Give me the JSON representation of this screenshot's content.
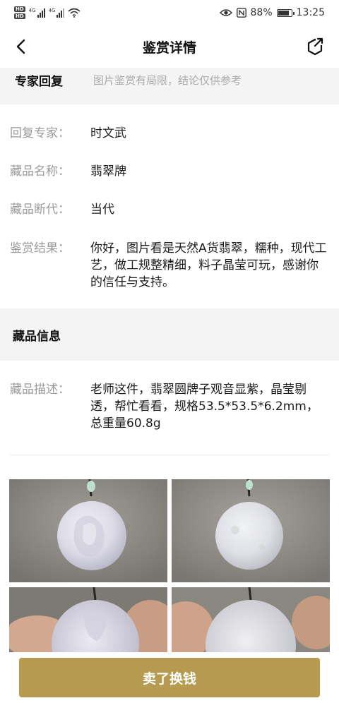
{
  "status_bar": {
    "network_left": [
      "HD",
      "HD"
    ],
    "sig1_tag": "4G",
    "sig2_tag": "4G",
    "battery_percent": "88%",
    "battery_level": 0.88,
    "time": "13:25",
    "icons": [
      "hd-icon",
      "signal-icon",
      "wifi-icon",
      "eye-icon",
      "nfc-icon",
      "battery-icon"
    ]
  },
  "nav": {
    "title": "鉴赏详情",
    "back_icon": "chevron-left-icon",
    "share_icon": "share-icon"
  },
  "expert_section": {
    "title": "专家回复",
    "note": "图片鉴赏有局限，结论仅供参考"
  },
  "expert_reply": [
    {
      "label": "回复专家：",
      "value": "时文武"
    },
    {
      "label": "藏品名称：",
      "value": "翡翠牌"
    },
    {
      "label": "藏品断代：",
      "value": "当代"
    },
    {
      "label": "鉴赏结果：",
      "value": "你好，图片看是天然A货翡翠，糯种，现代工艺，做工规整精细，料子晶莹可玩，感谢你的信任与支持。"
    }
  ],
  "info_section": {
    "title": "藏品信息"
  },
  "item_info": {
    "label": "藏品描述：",
    "value": "老师这件，翡翠圆牌子观音显紫，晶莹剔透，帮忙看看，规格53.5*53.5*6.2mm，总重量60.8g"
  },
  "photos": [
    "jade-pendant-front",
    "jade-pendant-back",
    "jade-pendant-front-in-hand",
    "jade-pendant-back-in-hand"
  ],
  "colors": {
    "accent": "#b69a4f",
    "section_bg": "#f4f4f4",
    "label_gray": "#9a9a9a"
  },
  "actions": {
    "sell_label": "卖了换钱"
  }
}
